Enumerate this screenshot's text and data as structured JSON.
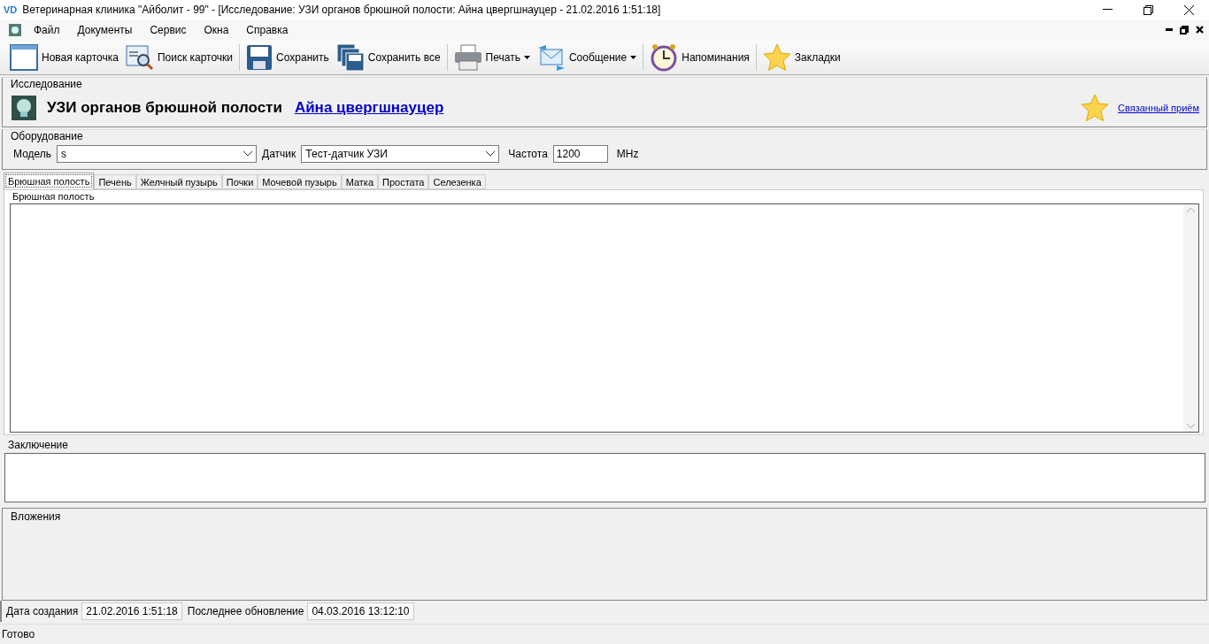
{
  "window": {
    "logo": "VD",
    "title": "Ветеринарная клиника \"Айболит - 99\" - [Исследование: УЗИ органов брюшной полости: Айна цвергшнауцер - 21.02.2016 1:51:18]"
  },
  "menu": [
    "Файл",
    "Документы",
    "Сервис",
    "Окна",
    "Справка"
  ],
  "toolbar": [
    {
      "label": "Новая карточка",
      "kind": "card",
      "has_menu": false
    },
    {
      "label": "Поиск карточки",
      "kind": "search",
      "has_menu": false
    },
    {
      "label": "Сохранить",
      "kind": "save",
      "has_menu": false
    },
    {
      "label": "Сохранить все",
      "kind": "saveall",
      "has_menu": false
    },
    {
      "label": "Печать",
      "kind": "print",
      "has_menu": true
    },
    {
      "label": "Сообщение",
      "kind": "message",
      "has_menu": true
    },
    {
      "label": "Напоминания",
      "kind": "clock",
      "has_menu": false
    },
    {
      "label": "Закладки",
      "kind": "star",
      "has_menu": false
    }
  ],
  "study": {
    "group_label": "Исследование",
    "title": "УЗИ органов брюшной полости",
    "patient_link": "Айна цвергшнауцер",
    "related_link": "Связанный приём"
  },
  "equipment": {
    "group_label": "Оборудование",
    "model_label": "Модель",
    "model_value": "s",
    "sensor_label": "Датчик",
    "sensor_value": "Тест-датчик УЗИ",
    "frequency_label": "Частота",
    "frequency_value": "1200",
    "frequency_unit": "MHz"
  },
  "tabs": [
    {
      "label": "Брюшная полость",
      "selected": true
    },
    {
      "label": "Печень",
      "selected": false
    },
    {
      "label": "Желчный пузырь",
      "selected": false
    },
    {
      "label": "Почки",
      "selected": false
    },
    {
      "label": "Мочевой пузырь",
      "selected": false
    },
    {
      "label": "Матка",
      "selected": false
    },
    {
      "label": "Простата",
      "selected": false
    },
    {
      "label": "Селезенка",
      "selected": false
    }
  ],
  "tab_page": {
    "group_label": "Брюшная полость"
  },
  "conclusion": {
    "group_label": "Заключение"
  },
  "attachments": {
    "group_label": "Вложения"
  },
  "dates": {
    "created_label": "Дата создания",
    "created_value": "21.02.2016 1:51:18",
    "updated_label": "Последнее обновление",
    "updated_value": "04.03.2016 13:12:10"
  },
  "status_bar": {
    "text": "Готово"
  }
}
